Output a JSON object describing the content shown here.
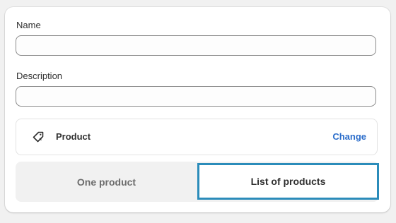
{
  "form": {
    "name_label": "Name",
    "name_value": "",
    "description_label": "Description",
    "description_value": ""
  },
  "product_picker": {
    "icon": "tag-icon",
    "label": "Product",
    "change_label": "Change",
    "change_color": "#2c6ecb"
  },
  "segmented_control": {
    "options": [
      "One product",
      "List of products"
    ],
    "selected": "List of products",
    "selected_border_color": "#2b8cba"
  }
}
